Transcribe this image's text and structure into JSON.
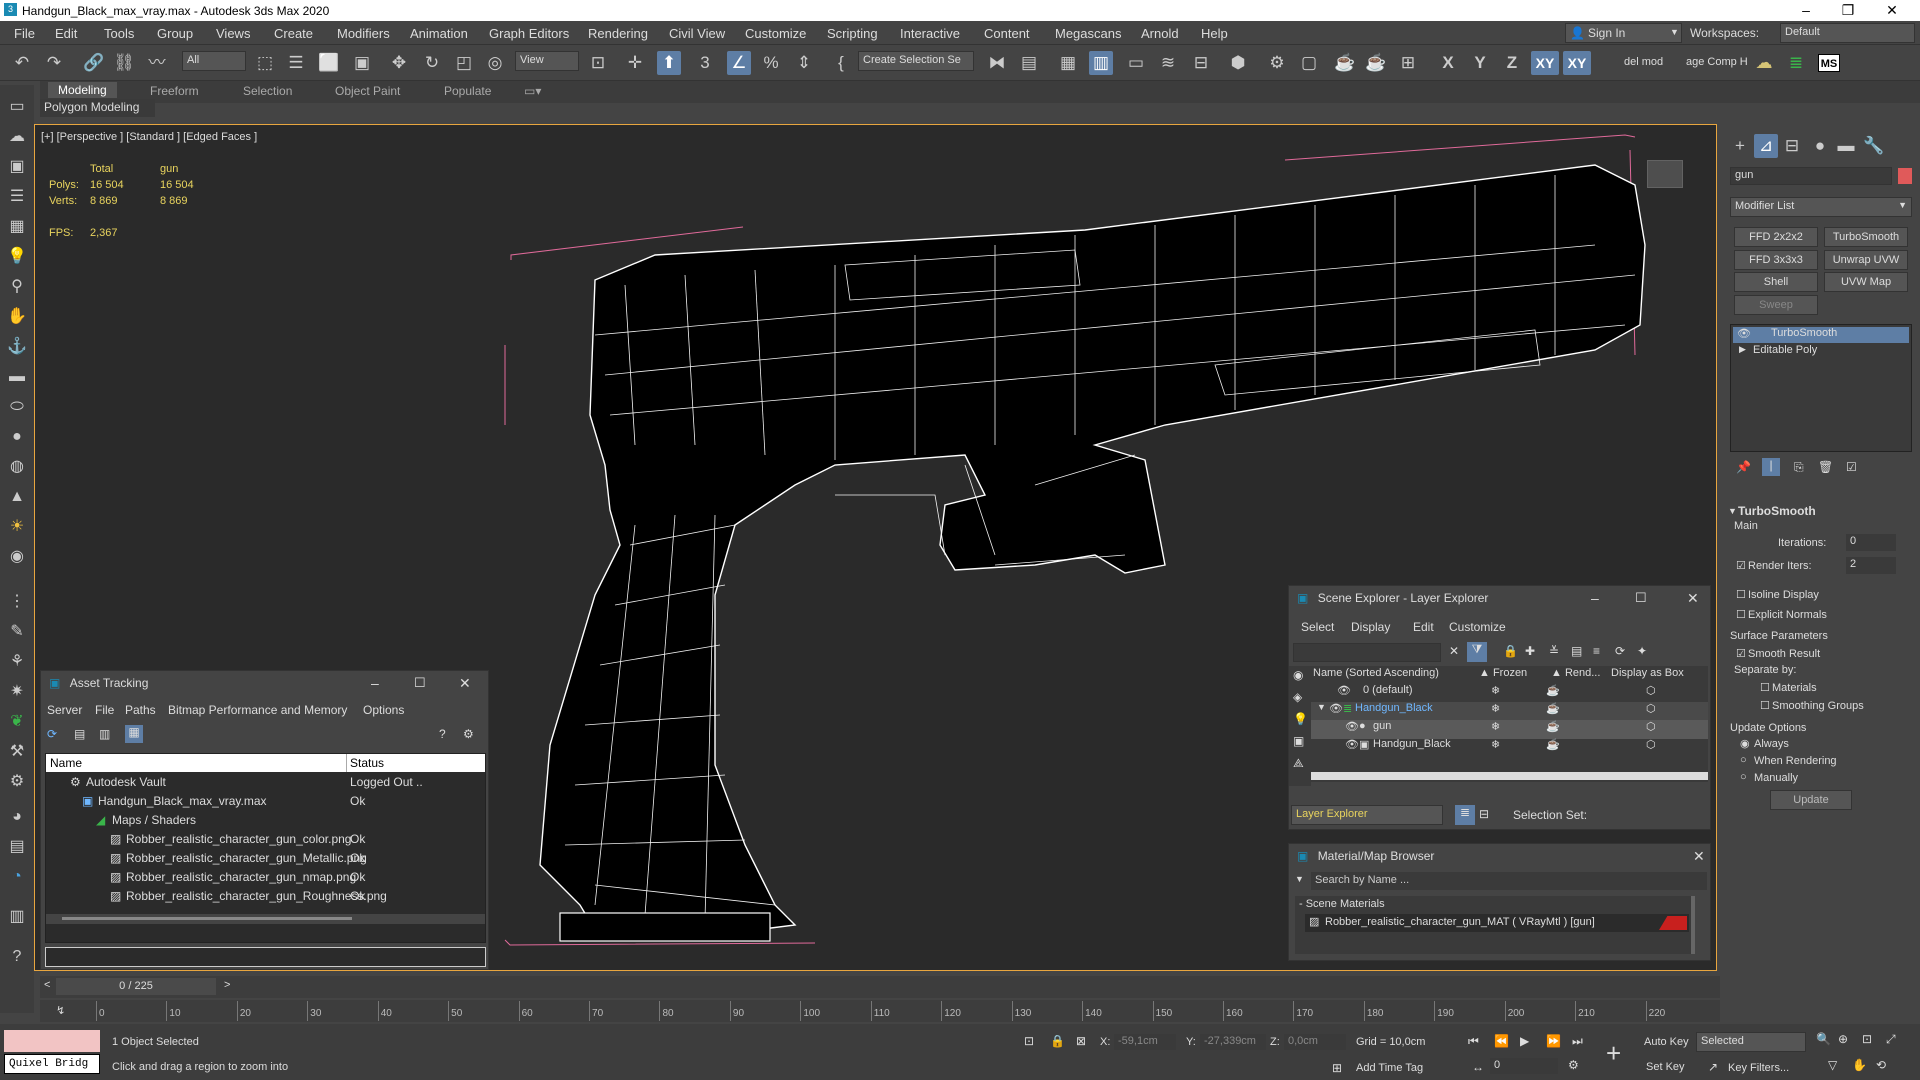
{
  "title": "Handgun_Black_max_vray.max - Autodesk 3ds Max 2020",
  "window_controls": [
    "–",
    "❐",
    "✕"
  ],
  "menus": [
    "File",
    "Edit",
    "Tools",
    "Group",
    "Views",
    "Create",
    "Modifiers",
    "Animation",
    "Graph Editors",
    "Rendering",
    "Civil View",
    "Customize",
    "Scripting",
    "Interactive",
    "Content",
    "Megascans",
    "Arnold",
    "Help"
  ],
  "account": {
    "sign_in": "Sign In",
    "workspaces_label": "Workspaces:",
    "workspace": "Default"
  },
  "toolbar": {
    "filter": "All",
    "view": "View",
    "selection_set": "Create Selection Se",
    "axes": [
      "X",
      "Y",
      "Z",
      "XY",
      "XY"
    ],
    "del_mod": "del mod",
    "comp_help": "age Comp Hel",
    "ms": "MS"
  },
  "ribbon": {
    "tabs": [
      "Modeling",
      "Freeform",
      "Selection",
      "Object Paint",
      "Populate"
    ],
    "sub": "Polygon Modeling"
  },
  "viewport": {
    "label": "[+] [Perspective ] [Standard ] [Edged Faces ]",
    "stats": {
      "col_total": "Total",
      "col_obj": "gun",
      "polys_label": "Polys:",
      "polys_total": "16 504",
      "polys_obj": "16 504",
      "verts_label": "Verts:",
      "verts_total": "8 869",
      "verts_obj": "8 869",
      "fps_label": "FPS:",
      "fps": "2,367"
    }
  },
  "asset_tracking": {
    "title": "Asset Tracking",
    "menus": [
      "Server",
      "File",
      "Paths",
      "Bitmap Performance and Memory",
      "Options"
    ],
    "cols": [
      "Name",
      "Status"
    ],
    "rows": [
      {
        "name": "Autodesk Vault",
        "status": "Logged Out ..",
        "indent": 0
      },
      {
        "name": "Handgun_Black_max_vray.max",
        "status": "Ok",
        "indent": 1
      },
      {
        "name": "Maps / Shaders",
        "status": "",
        "indent": 2
      },
      {
        "name": "Robber_realistic_character_gun_color.png",
        "status": "Ok",
        "indent": 3
      },
      {
        "name": "Robber_realistic_character_gun_Metallic.png",
        "status": "Ok",
        "indent": 3
      },
      {
        "name": "Robber_realistic_character_gun_nmap.png",
        "status": "Ok",
        "indent": 3
      },
      {
        "name": "Robber_realistic_character_gun_Roughness.png",
        "status": "Ok",
        "indent": 3
      }
    ]
  },
  "scene_explorer": {
    "title": "Scene Explorer - Layer Explorer",
    "menus": [
      "Select",
      "Display",
      "Edit",
      "Customize"
    ],
    "cols": [
      "Name (Sorted Ascending)",
      "▲ Frozen",
      "▲ Rend...",
      "Display as Box"
    ],
    "rows": [
      {
        "name": "0 (default)",
        "indent": 0
      },
      {
        "name": "Handgun_Black",
        "indent": 0
      },
      {
        "name": "gun",
        "indent": 1
      },
      {
        "name": "Handgun_Black",
        "indent": 1
      }
    ],
    "footer": "Layer Explorer",
    "selection_set": "Selection Set:"
  },
  "material_browser": {
    "title": "Material/Map Browser",
    "search": "Search by Name ...",
    "group": "- Scene Materials",
    "material": "Robber_realistic_character_gun_MAT  ( VRayMtl ) [gun]"
  },
  "command_panel": {
    "object_name": "gun",
    "modifier_list": "Modifier List",
    "buttons": [
      "FFD 2x2x2",
      "TurboSmooth",
      "FFD 3x3x3",
      "Unwrap UVW",
      "Shell",
      "UVW Map",
      "Sweep"
    ],
    "stack": [
      "TurboSmooth",
      "Editable Poly"
    ],
    "rollout": {
      "title": "TurboSmooth",
      "main": "Main",
      "iterations_label": "Iterations:",
      "iterations": "0",
      "render_iters_label": "Render Iters:",
      "render_iters": "2",
      "isoline": "Isoline Display",
      "explicit": "Explicit Normals",
      "surface": "Surface Parameters",
      "smooth": "Smooth Result",
      "separate": "Separate by:",
      "materials": "Materials",
      "smoothing": "Smoothing Groups",
      "update_opts": "Update Options",
      "always": "Always",
      "when": "When Rendering",
      "manually": "Manually",
      "update": "Update"
    }
  },
  "timeline": {
    "frame": "0 / 225",
    "ticks": [
      "0",
      "10",
      "20",
      "30",
      "40",
      "50",
      "60",
      "70",
      "80",
      "90",
      "100",
      "110",
      "120",
      "130",
      "140",
      "150",
      "160",
      "170",
      "180",
      "190",
      "200",
      "210",
      "220"
    ]
  },
  "status": {
    "quixel": "Quixel Bridg",
    "selected": "1 Object Selected",
    "prompt": "Click and drag a region to zoom into",
    "x_label": "X:",
    "x": "-59,1cm",
    "y_label": "Y:",
    "y": "-27,339cm",
    "z_label": "Z:",
    "z": "0,0cm",
    "grid": "Grid = 10,0cm",
    "add_time_tag": "Add Time Tag",
    "auto_key": "Auto Key",
    "set_key": "Set Key",
    "selected_dd": "Selected",
    "key_filters": "Key Filters...",
    "frame_field": "0"
  },
  "colors": {
    "accent": "#5e7ea5",
    "viewport_border": "#e8a63f",
    "stats": "#e9d45e",
    "swatch": "#e05a5a",
    "material_red": "#c8201e"
  }
}
